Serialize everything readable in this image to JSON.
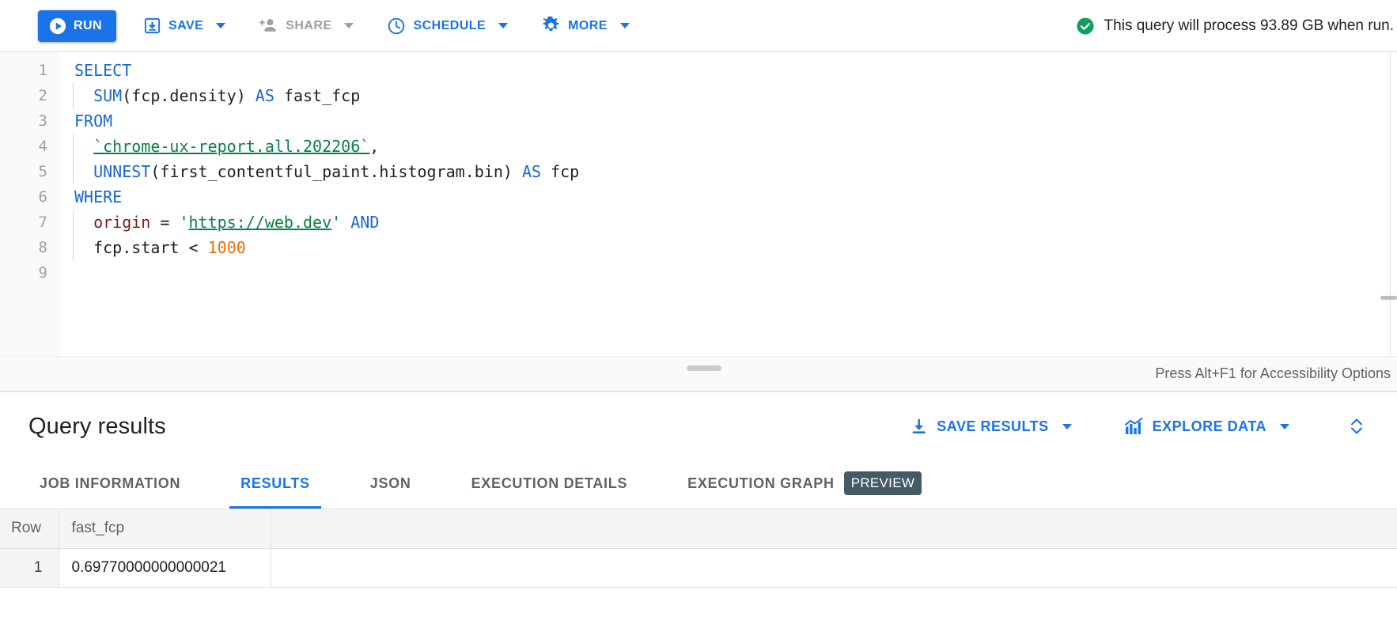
{
  "toolbar": {
    "run_label": "RUN",
    "save_label": "SAVE",
    "share_label": "SHARE",
    "schedule_label": "SCHEDULE",
    "more_label": "MORE",
    "query_note": "This query will process 93.89 GB when run.",
    "status_icon": "check-circle-icon",
    "status_color": "#0f9d58",
    "accent_color": "#1a73e8",
    "disabled_color": "#9aa0a6"
  },
  "editor": {
    "line_numbers": [
      "1",
      "2",
      "3",
      "4",
      "5",
      "6",
      "7",
      "8",
      "9"
    ],
    "lines": [
      {
        "num": "1",
        "tokens": [
          {
            "t": "SELECT",
            "c": "k"
          }
        ]
      },
      {
        "num": "2",
        "indent": true,
        "tokens": [
          {
            "t": "  ",
            "c": "id"
          },
          {
            "t": "SUM",
            "c": "k"
          },
          {
            "t": "(fcp.density) ",
            "c": "id"
          },
          {
            "t": "AS",
            "c": "k"
          },
          {
            "t": " fast_fcp",
            "c": "id"
          }
        ]
      },
      {
        "num": "3",
        "tokens": [
          {
            "t": "FROM",
            "c": "k"
          }
        ]
      },
      {
        "num": "4",
        "indent": true,
        "tokens": [
          {
            "t": "  ",
            "c": "id"
          },
          {
            "t": "`chrome-ux-report.all.202206`",
            "c": "str-u"
          },
          {
            "t": ",",
            "c": "id"
          }
        ]
      },
      {
        "num": "5",
        "indent": true,
        "tokens": [
          {
            "t": "  ",
            "c": "id"
          },
          {
            "t": "UNNEST",
            "c": "k"
          },
          {
            "t": "(first_contentful_paint.histogram.bin) ",
            "c": "id"
          },
          {
            "t": "AS",
            "c": "k"
          },
          {
            "t": " fcp",
            "c": "id"
          }
        ]
      },
      {
        "num": "6",
        "tokens": [
          {
            "t": "WHERE",
            "c": "k"
          }
        ]
      },
      {
        "num": "7",
        "indent": true,
        "tokens": [
          {
            "t": "  ",
            "c": "id"
          },
          {
            "t": "origin",
            "c": "col"
          },
          {
            "t": " = ",
            "c": "id"
          },
          {
            "t": "'",
            "c": "str"
          },
          {
            "t": "https://web.dev",
            "c": "str-u"
          },
          {
            "t": "'",
            "c": "str"
          },
          {
            "t": " ",
            "c": "id"
          },
          {
            "t": "AND",
            "c": "k"
          }
        ]
      },
      {
        "num": "8",
        "indent": true,
        "tokens": [
          {
            "t": "  ",
            "c": "id"
          },
          {
            "t": "fcp.start ",
            "c": "id"
          },
          {
            "t": "< ",
            "c": "id"
          },
          {
            "t": "1000",
            "c": "num"
          }
        ]
      },
      {
        "num": "9",
        "tokens": []
      }
    ],
    "accessibility_hint": "Press Alt+F1 for Accessibility Options"
  },
  "results": {
    "title": "Query results",
    "save_results_label": "SAVE RESULTS",
    "explore_data_label": "EXPLORE DATA",
    "expand_icon": "expand-collapse-icon",
    "tabs": [
      {
        "label": "JOB INFORMATION",
        "active": false,
        "badge": ""
      },
      {
        "label": "RESULTS",
        "active": true,
        "badge": ""
      },
      {
        "label": "JSON",
        "active": false,
        "badge": ""
      },
      {
        "label": "EXECUTION DETAILS",
        "active": false,
        "badge": ""
      },
      {
        "label": "EXECUTION GRAPH",
        "active": false,
        "badge": "PREVIEW"
      }
    ],
    "table": {
      "columns": [
        "Row",
        "fast_fcp"
      ],
      "rows": [
        {
          "row": "1",
          "fast_fcp": "0.69770000000000021"
        }
      ]
    }
  }
}
